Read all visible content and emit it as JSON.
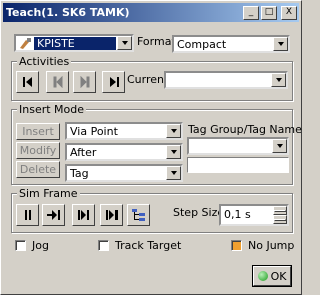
{
  "window": {
    "title": "Teach(1. SK6 TAMK)"
  },
  "titlebar_buttons": {
    "minimize": "_",
    "maximize": "□",
    "close": "X"
  },
  "header": {
    "tool_value": "KPISTE",
    "format_label": "Format",
    "format_value": "Compact"
  },
  "activities": {
    "label": "Activities",
    "current_label": "Current",
    "current_value": ""
  },
  "insert_mode": {
    "label": "Insert Mode",
    "insert_label": "Insert",
    "modify_label": "Modify",
    "delete_label": "Delete",
    "motion_value": "Via Point",
    "position_value": "After",
    "type_value": "Tag",
    "tag_group_label": "Tag Group/Tag Name",
    "tag_group_value": "",
    "tag_name_value": ""
  },
  "sim_frame": {
    "label": "Sim Frame",
    "step_size_label": "Step Size",
    "step_size_value": "0,1 s"
  },
  "options": {
    "jog_label": "Jog",
    "track_target_label": "Track Target",
    "no_jump_label": "No Jump"
  },
  "ok_label": "OK",
  "colors": {
    "title_start": "#0a246a",
    "title_end": "#a6caf0",
    "face": "#d4d0c8",
    "no_jump_check": "#f0a030",
    "ok_icon": "#1a9a1a"
  }
}
